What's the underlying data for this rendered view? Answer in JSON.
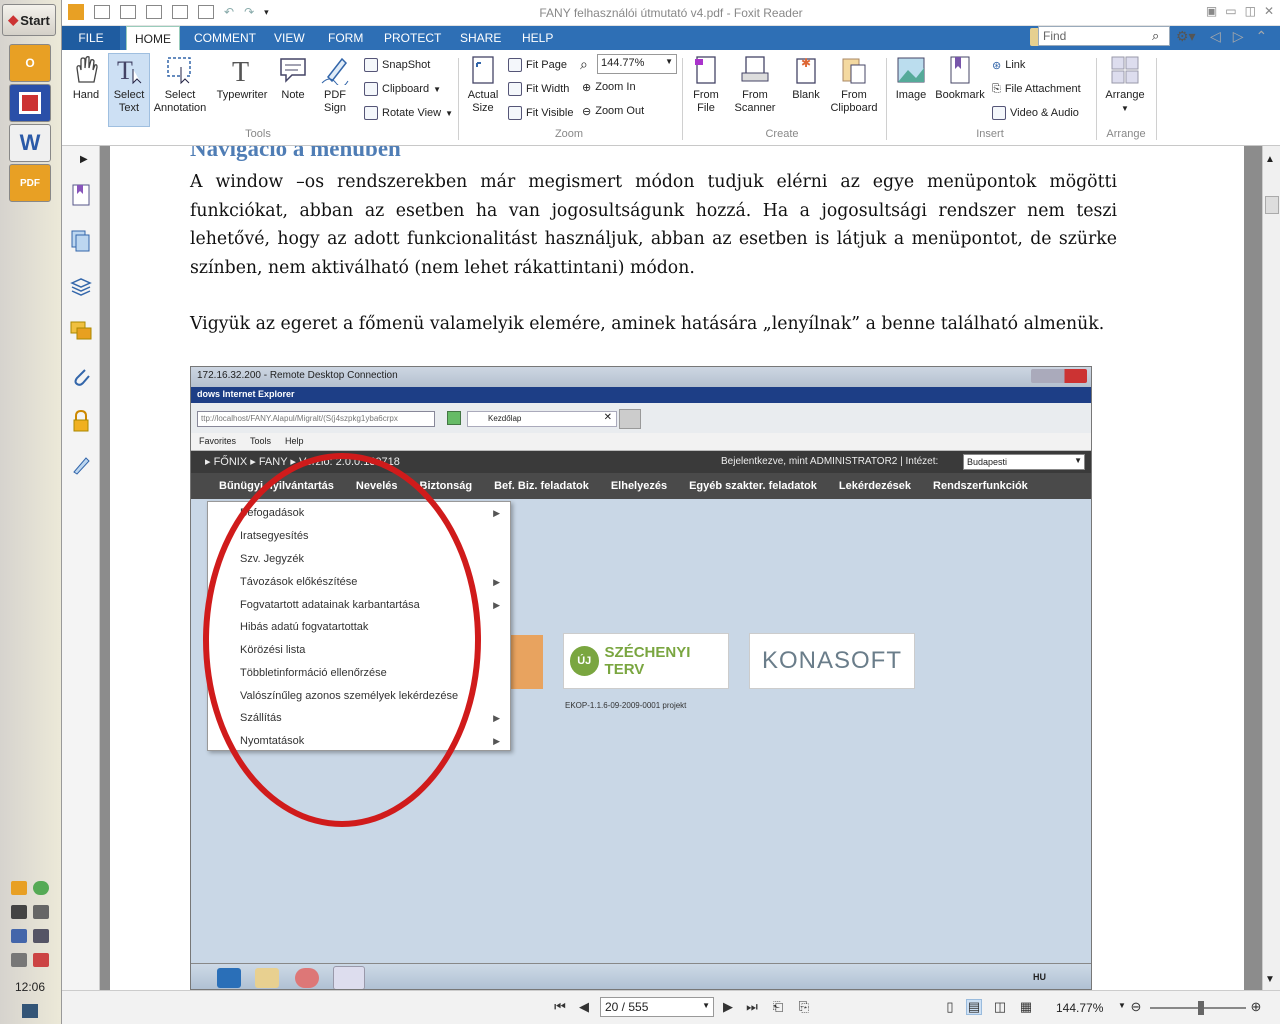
{
  "taskbar": {
    "start_label": "Start",
    "clock": "12:06",
    "apps": [
      {
        "name": "outlook",
        "label": "O",
        "color": "#e8a024"
      },
      {
        "name": "save",
        "label": "",
        "color": "#2a4fa8"
      },
      {
        "name": "word",
        "label": "W",
        "color": "#2b5aa8"
      },
      {
        "name": "pdf",
        "label": "PDF",
        "color": "#e8a024"
      }
    ]
  },
  "window": {
    "title": "FANY felhasználói útmutató v4.pdf - Foxit Reader",
    "find_placeholder": "Find"
  },
  "menu": {
    "tabs": [
      "FILE",
      "HOME",
      "COMMENT",
      "VIEW",
      "FORM",
      "PROTECT",
      "SHARE",
      "HELP"
    ],
    "active": "HOME"
  },
  "ribbon": {
    "tools": {
      "label": "Tools",
      "hand": "Hand",
      "select_text": "Select\nText",
      "select_annotation": "Select\nAnnotation",
      "typewriter": "Typewriter",
      "note": "Note",
      "pdf_sign": "PDF\nSign"
    },
    "snapshot": "SnapShot",
    "clipboard": "Clipboard",
    "rotate_view": "Rotate View",
    "zoom": {
      "label": "Zoom",
      "actual_size": "Actual\nSize",
      "fit_page": "Fit Page",
      "fit_width": "Fit Width",
      "fit_visible": "Fit Visible",
      "zoom_value": "144.77%",
      "zoom_in": "Zoom In",
      "zoom_out": "Zoom Out"
    },
    "create": {
      "label": "Create",
      "from_file": "From\nFile",
      "from_scanner": "From\nScanner",
      "blank": "Blank",
      "from_clipboard": "From\nClipboard"
    },
    "insert": {
      "label": "Insert",
      "image": "Image",
      "bookmark": "Bookmark",
      "link": "Link",
      "file_attachment": "File Attachment",
      "video_audio": "Video & Audio"
    },
    "arrange": {
      "label": "Arrange",
      "arrange": "Arrange"
    }
  },
  "document": {
    "heading": "Navigáció a menüben",
    "paragraph1": "A window –os rendszerekben már megismert módon tudjuk elérni az egye menüpontok mögötti funkciókat, abban az esetben ha van jogosultságunk hozzá. Ha a jogosultsági rendszer nem teszi lehetővé, hogy az adott funkcionalitást használjuk, abban az esetben is látjuk a menüpontot, de szürke színben, nem aktiválható (nem lehet rákattintani) módon.",
    "paragraph2": "Vigyük az egeret a főmenü valamelyik elemére, aminek hatására „lenyílnak” a benne található almenük."
  },
  "screenshot": {
    "rdp_title": "172.16.32.200 - Remote Desktop Connection",
    "ie_title": "dows Internet Explorer",
    "address": "ttp://localhost/FANY.Alapul/Migralt/(S(j4szpkg1yba6crpx",
    "tab_label": "Kezdőlap",
    "fav_items": [
      "Favorites",
      "Tools",
      "Help"
    ],
    "breadcrumb": "▸ FŐNIX  ▸ FANY  ▸ Verzió: 2.0.0.130718",
    "logged_in": "Bejelentkezve, mint ADMINISTRATOR2 | Intézet:",
    "institute": "Budapesti",
    "nav": [
      "Bűnügyi nyilvántartás",
      "Nevelés",
      "Biztonság",
      "Bef. Biz. feladatok",
      "Elhelyezés",
      "Egyéb szakter. feladatok",
      "Lekérdezések",
      "Rendszerfunkciók"
    ],
    "menu_items": [
      {
        "label": "Befogadások",
        "sub": true
      },
      {
        "label": "Iratsegyesítés",
        "sub": false
      },
      {
        "label": "Szv. Jegyzék",
        "sub": false
      },
      {
        "label": "Távozások előkészítése",
        "sub": true
      },
      {
        "label": "Fogvatartott adatainak karbantartása",
        "sub": true
      },
      {
        "label": "Hibás adatú fogvatartottak",
        "sub": false
      },
      {
        "label": "Körözési lista",
        "sub": false
      },
      {
        "label": "Többletinformáció ellenőrzése",
        "sub": false
      },
      {
        "label": "Valószínűleg azonos személyek lekérdezése",
        "sub": false
      },
      {
        "label": "Szállítás",
        "sub": true
      },
      {
        "label": "Nyomtatások",
        "sub": true
      }
    ],
    "szechenyi": "SZÉCHENYI TERV",
    "szechenyi_badge": "ÚJ",
    "konasoft": "KONASOFT",
    "ekop": "EKOP-1.1.6-09-2009-0001 projekt",
    "lang": "HU"
  },
  "status": {
    "page": "20 / 555",
    "zoom": "144.77%"
  }
}
